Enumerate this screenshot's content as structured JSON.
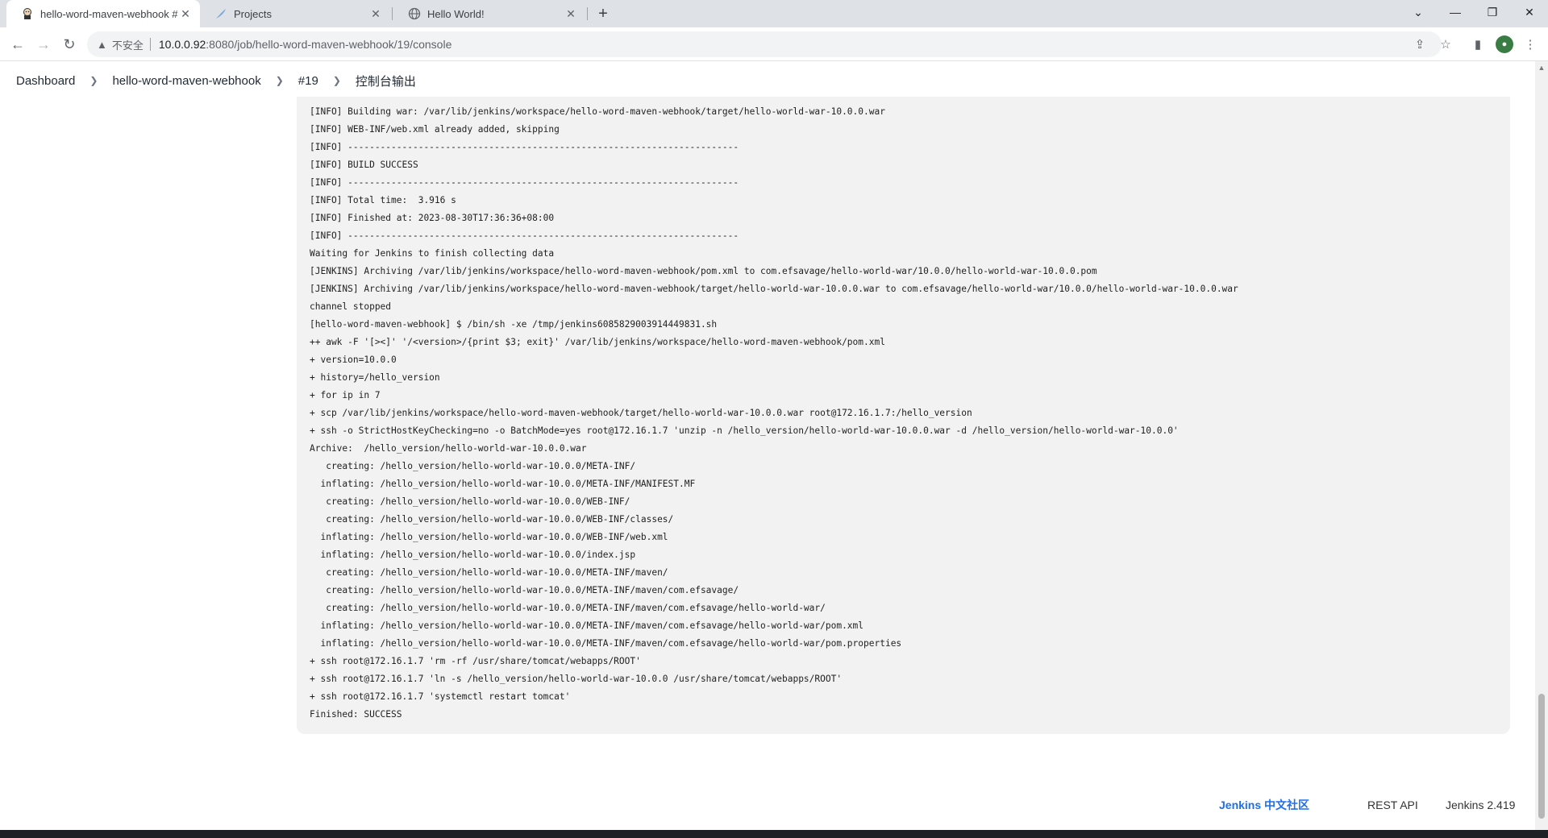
{
  "browser": {
    "tabs": [
      {
        "title": "hello-word-maven-webhook #",
        "icon": "jenkins-butler-icon",
        "active": true
      },
      {
        "title": "Projects",
        "icon": "gitlab-feather-icon",
        "active": false
      },
      {
        "title": "Hello World!",
        "icon": "globe-icon",
        "active": false
      }
    ],
    "address": {
      "insecure_label": "不安全",
      "host": "10.0.0.92",
      "path": ":8080/job/hello-word-maven-webhook/19/console"
    }
  },
  "breadcrumb": {
    "items": [
      "Dashboard",
      "hello-word-maven-webhook",
      "#19",
      "控制台输出"
    ]
  },
  "console": {
    "lines": [
      "[INFO] Building war: /var/lib/jenkins/workspace/hello-word-maven-webhook/target/hello-world-war-10.0.0.war",
      "[INFO] WEB-INF/web.xml already added, skipping",
      "[INFO] ------------------------------------------------------------------------",
      "[INFO] BUILD SUCCESS",
      "[INFO] ------------------------------------------------------------------------",
      "[INFO] Total time:  3.916 s",
      "[INFO] Finished at: 2023-08-30T17:36:36+08:00",
      "[INFO] ------------------------------------------------------------------------",
      "Waiting for Jenkins to finish collecting data",
      "[JENKINS] Archiving /var/lib/jenkins/workspace/hello-word-maven-webhook/pom.xml to com.efsavage/hello-world-war/10.0.0/hello-world-war-10.0.0.pom",
      "[JENKINS] Archiving /var/lib/jenkins/workspace/hello-word-maven-webhook/target/hello-world-war-10.0.0.war to com.efsavage/hello-world-war/10.0.0/hello-world-war-10.0.0.war",
      "channel stopped",
      "[hello-word-maven-webhook] $ /bin/sh -xe /tmp/jenkins6085829003914449831.sh",
      "++ awk -F '[><]' '/<version>/{print $3; exit}' /var/lib/jenkins/workspace/hello-word-maven-webhook/pom.xml",
      "+ version=10.0.0",
      "+ history=/hello_version",
      "+ for ip in 7",
      "+ scp /var/lib/jenkins/workspace/hello-word-maven-webhook/target/hello-world-war-10.0.0.war root@172.16.1.7:/hello_version",
      "+ ssh -o StrictHostKeyChecking=no -o BatchMode=yes root@172.16.1.7 'unzip -n /hello_version/hello-world-war-10.0.0.war -d /hello_version/hello-world-war-10.0.0'",
      "Archive:  /hello_version/hello-world-war-10.0.0.war",
      "   creating: /hello_version/hello-world-war-10.0.0/META-INF/",
      "  inflating: /hello_version/hello-world-war-10.0.0/META-INF/MANIFEST.MF",
      "   creating: /hello_version/hello-world-war-10.0.0/WEB-INF/",
      "   creating: /hello_version/hello-world-war-10.0.0/WEB-INF/classes/",
      "  inflating: /hello_version/hello-world-war-10.0.0/WEB-INF/web.xml",
      "  inflating: /hello_version/hello-world-war-10.0.0/index.jsp",
      "   creating: /hello_version/hello-world-war-10.0.0/META-INF/maven/",
      "   creating: /hello_version/hello-world-war-10.0.0/META-INF/maven/com.efsavage/",
      "   creating: /hello_version/hello-world-war-10.0.0/META-INF/maven/com.efsavage/hello-world-war/",
      "  inflating: /hello_version/hello-world-war-10.0.0/META-INF/maven/com.efsavage/hello-world-war/pom.xml",
      "  inflating: /hello_version/hello-world-war-10.0.0/META-INF/maven/com.efsavage/hello-world-war/pom.properties",
      "+ ssh root@172.16.1.7 'rm -rf /usr/share/tomcat/webapps/ROOT'",
      "+ ssh root@172.16.1.7 'ln -s /hello_version/hello-world-war-10.0.0 /usr/share/tomcat/webapps/ROOT'",
      "+ ssh root@172.16.1.7 'systemctl restart tomcat'",
      "Finished: SUCCESS"
    ]
  },
  "footer": {
    "community": "Jenkins 中文社区",
    "rest_api": "REST API",
    "version": "Jenkins 2.419"
  },
  "colors": {
    "link_accent": "#1f6feb",
    "console_bg": "#f2f2f3"
  }
}
